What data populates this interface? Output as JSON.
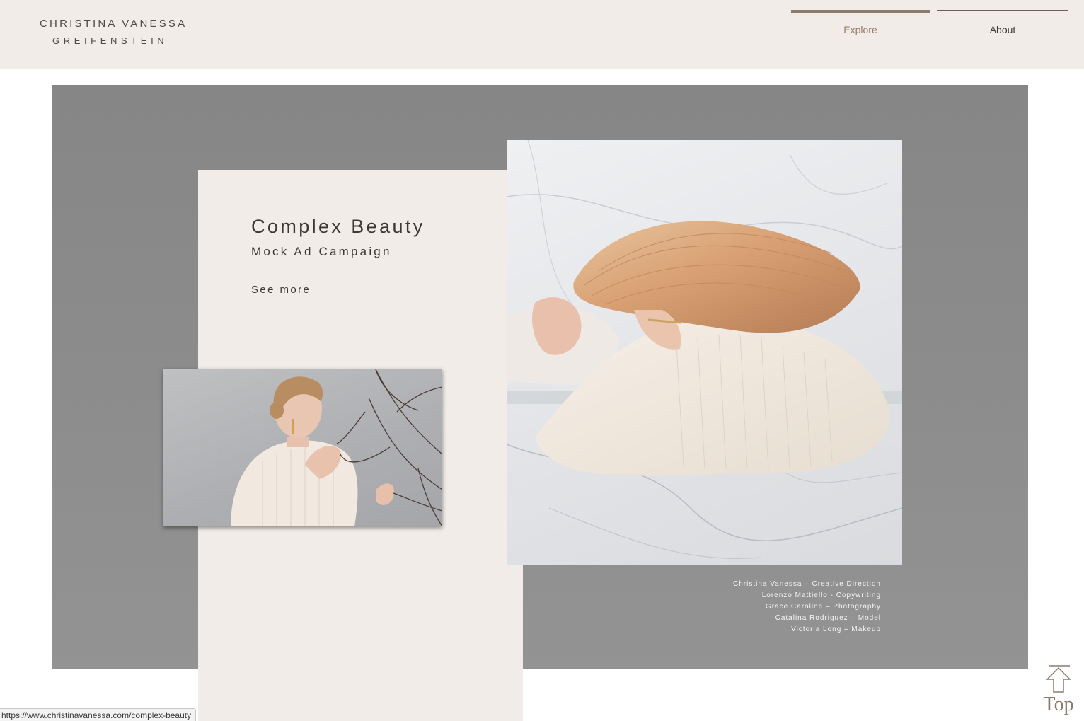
{
  "header": {
    "logo_line1": "CHRISTINA VANESSA",
    "logo_line2": "GREIFENSTEIN",
    "nav": [
      {
        "label": "Explore",
        "active": true
      },
      {
        "label": "About",
        "active": false
      }
    ]
  },
  "project": {
    "title": "Complex Beauty",
    "subtitle": "Mock Ad Campaign",
    "link_label": "See more",
    "credits": [
      "Christina Vanessa – Creative Direction",
      "Lorenzo Mattiello - Copywriting",
      "Grace Caroline – Photography",
      "Catalina Rodriguez – Model",
      "Victoria Long – Makeup"
    ]
  },
  "top_button": {
    "label": "Top",
    "icon": "arrow-up-icon"
  },
  "status_bar": {
    "url": "https://www.christinavanessa.com/complex-beauty"
  },
  "colors": {
    "header_bg": "#f1ece8",
    "card_bg": "#f1ece8",
    "section_bg": "#8b8b8b",
    "accent": "#8d7a6e",
    "text": "#3b3937"
  }
}
